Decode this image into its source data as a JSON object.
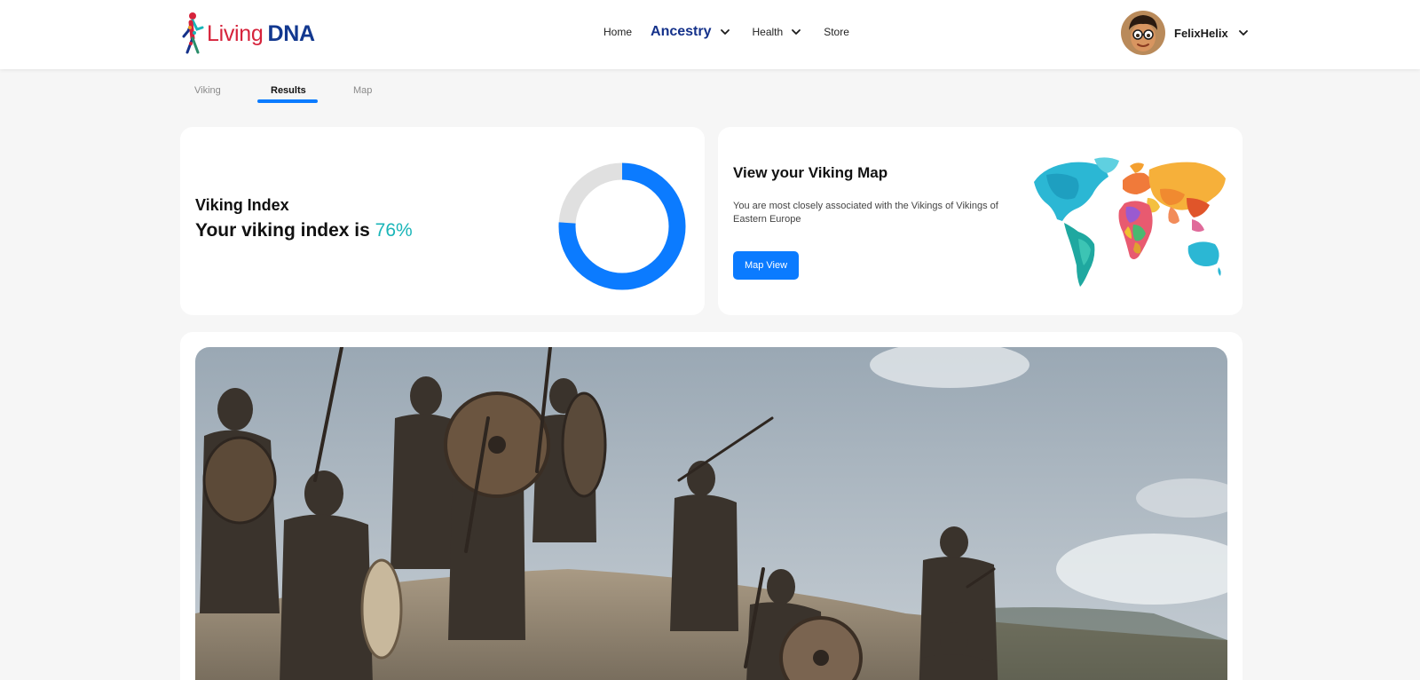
{
  "header": {
    "logo": {
      "word1": "Living",
      "word2": "DNA"
    },
    "nav": {
      "home": "Home",
      "ancestry": "Ancestry",
      "health": "Health",
      "store": "Store"
    },
    "user": {
      "name": "FelixHelix"
    }
  },
  "tabs": [
    {
      "label": "Viking",
      "active": false
    },
    {
      "label": "Results",
      "active": true
    },
    {
      "label": "Map",
      "active": false
    }
  ],
  "viking_index": {
    "title": "Viking Index",
    "line_prefix": "Your viking index is ",
    "value_text": "76%",
    "value": 76
  },
  "viking_map": {
    "title": "View your Viking Map",
    "description": "You are most closely associated with the Vikings of Vikings of Eastern Europe",
    "button": "Map View"
  },
  "colors": {
    "accent": "#0b7bff",
    "index_value": "#19b5b8",
    "brand_red": "#d6233b",
    "brand_blue": "#12388f",
    "donut_track": "#e0e0e0"
  },
  "icons": {
    "chevron": "chevron-down-icon",
    "avatar": "cartoon-avatar",
    "logo": "dna-figure-logo"
  }
}
